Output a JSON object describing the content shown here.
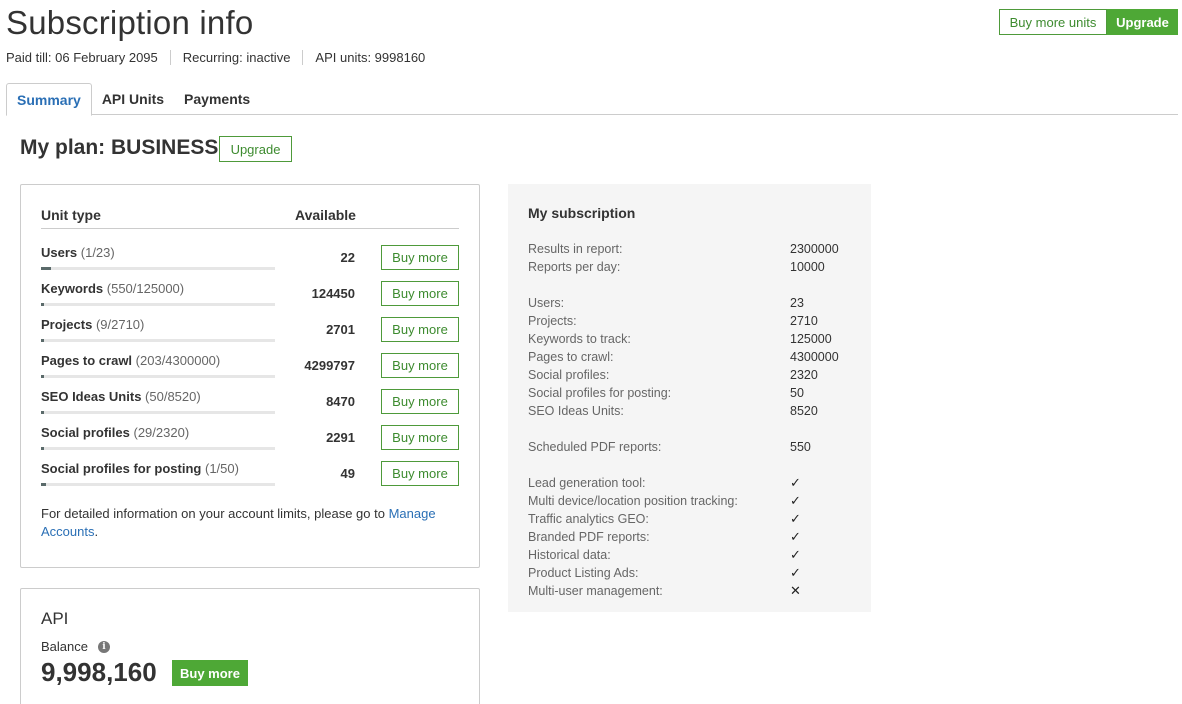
{
  "header": {
    "title": "Subscription info",
    "paid_till": "Paid till: 06 February 2095",
    "recurring": "Recurring: inactive",
    "api_units": "API units: 9998160",
    "buy_more_units": "Buy more units",
    "upgrade": "Upgrade"
  },
  "tabs": [
    {
      "label": "Summary",
      "active": true
    },
    {
      "label": "API Units",
      "active": false
    },
    {
      "label": "Payments",
      "active": false
    }
  ],
  "plan": {
    "title": "My plan: BUSINESS",
    "upgrade": "Upgrade"
  },
  "units": {
    "col_type": "Unit type",
    "col_available": "Available",
    "buy_label": "Buy more",
    "rows": [
      {
        "name": "Users",
        "usage": "(1/23)",
        "available": "22",
        "used_fraction": 0.043
      },
      {
        "name": "Keywords",
        "usage": "(550/125000)",
        "available": "124450",
        "used_fraction": 0.0044
      },
      {
        "name": "Projects",
        "usage": "(9/2710)",
        "available": "2701",
        "used_fraction": 0.0033
      },
      {
        "name": "Pages to crawl",
        "usage": "(203/4300000)",
        "available": "4299797",
        "used_fraction": 5e-05
      },
      {
        "name": "SEO Ideas Units",
        "usage": "(50/8520)",
        "available": "8470",
        "used_fraction": 0.0059
      },
      {
        "name": "Social profiles",
        "usage": "(29/2320)",
        "available": "2291",
        "used_fraction": 0.0125
      },
      {
        "name": "Social profiles for posting",
        "usage": "(1/50)",
        "available": "49",
        "used_fraction": 0.02
      }
    ],
    "note_text": "For detailed information on your account limits, please go to ",
    "note_link": "Manage Accounts",
    "note_end": "."
  },
  "api": {
    "title": "API",
    "balance_label": "Balance",
    "balance": "9,998,160",
    "buy_label": "Buy more"
  },
  "subscription": {
    "title": "My subscription",
    "rows": [
      {
        "label": "Results in report:",
        "value": "2300000"
      },
      {
        "label": "Reports per day:",
        "value": "10000"
      },
      {
        "label": "Users:",
        "value": "23"
      },
      {
        "label": "Projects:",
        "value": "2710"
      },
      {
        "label": "Keywords to track:",
        "value": "125000"
      },
      {
        "label": "Pages to crawl:",
        "value": "4300000"
      },
      {
        "label": "Social profiles:",
        "value": "2320"
      },
      {
        "label": "Social profiles for posting:",
        "value": "50"
      },
      {
        "label": "SEO Ideas Units:",
        "value": "8520"
      },
      {
        "label": "Scheduled PDF reports:",
        "value": "550"
      },
      {
        "label": "Lead generation tool:",
        "value": "✓"
      },
      {
        "label": "Multi device/location position tracking:",
        "value": "✓"
      },
      {
        "label": "Traffic analytics GEO:",
        "value": "✓"
      },
      {
        "label": "Branded PDF reports:",
        "value": "✓"
      },
      {
        "label": "Historical data:",
        "value": "✓"
      },
      {
        "label": "Product Listing Ads:",
        "value": "✓"
      },
      {
        "label": "Multi-user management:",
        "value": "✕"
      }
    ]
  },
  "colors": {
    "accent_green": "#4ea836",
    "link_blue": "#2a6fb5",
    "panel_gray": "#f5f5f5"
  }
}
